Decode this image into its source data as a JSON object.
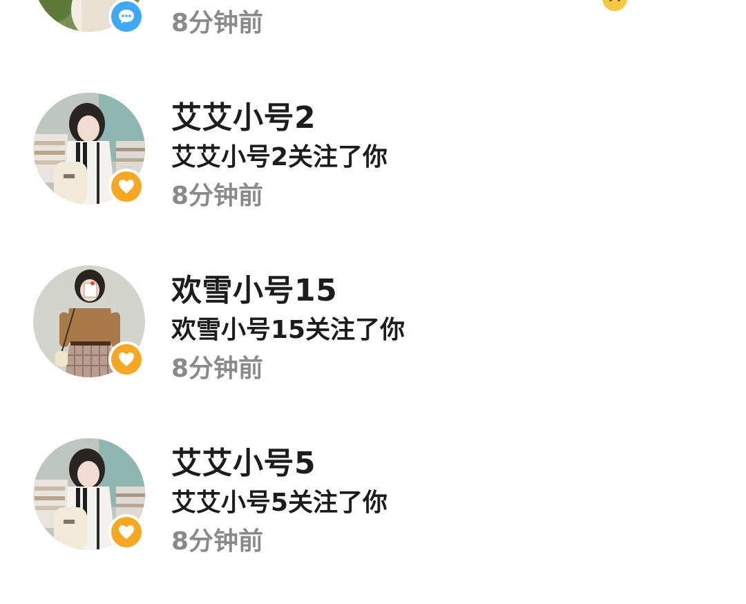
{
  "partial_item": {
    "time": "8分钟前",
    "badge_icon": "chat-bubble-icon",
    "corner_icon": "emoji-icon"
  },
  "notifications": [
    {
      "name": "艾艾小号2",
      "message": "艾艾小号2关注了你",
      "time": "8分钟前",
      "badge_icon": "heart-icon",
      "avatar": "girl-with-backpack-photo"
    },
    {
      "name": "欢雪小号15",
      "message": "欢雪小号15关注了你",
      "time": "8分钟前",
      "badge_icon": "heart-icon",
      "avatar": "girl-illustration"
    },
    {
      "name": "艾艾小号5",
      "message": "艾艾小号5关注了你",
      "time": "8分钟前",
      "badge_icon": "heart-icon",
      "avatar": "girl-with-backpack-photo"
    }
  ],
  "colors": {
    "follow_badge": "#f7a823",
    "comment_badge": "#3fa9f5",
    "name_text": "#1c1c1c",
    "time_text": "#8a8a8a"
  }
}
